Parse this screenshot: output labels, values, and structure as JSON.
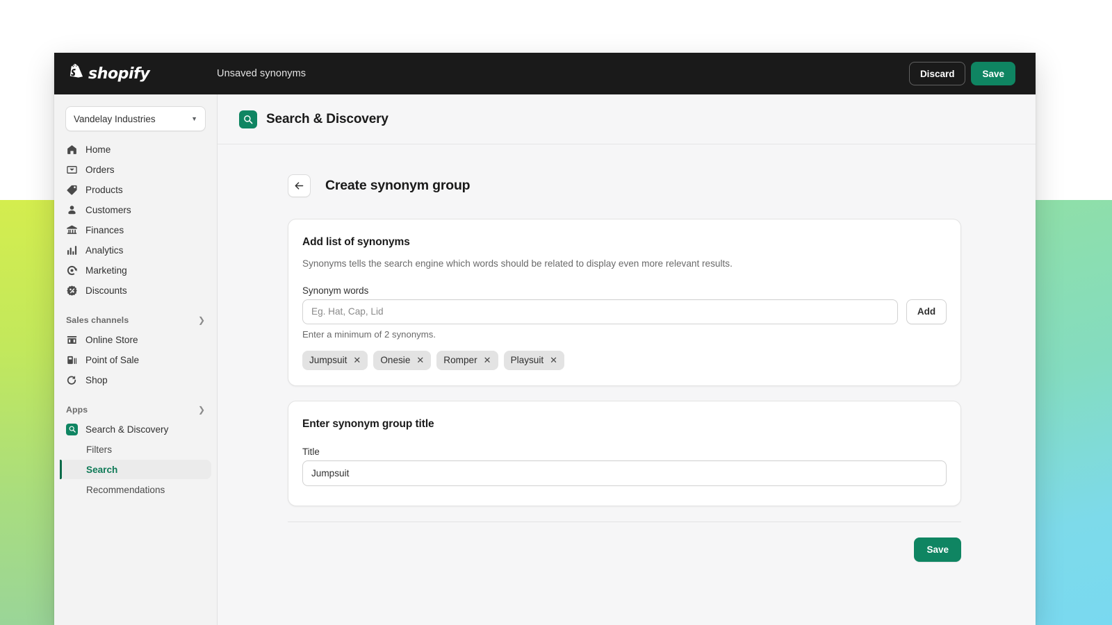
{
  "topbar": {
    "logo_text": "shopify",
    "logo_icon": "shopify-bag-icon",
    "title": "Unsaved synonyms",
    "discard_label": "Discard",
    "save_label": "Save"
  },
  "sidebar": {
    "store_name": "Vandelay Industries",
    "store_caret_icon": "caret-down-icon",
    "items": [
      {
        "label": "Home",
        "icon": "home-icon"
      },
      {
        "label": "Orders",
        "icon": "orders-inbox-icon"
      },
      {
        "label": "Products",
        "icon": "price-tag-icon"
      },
      {
        "label": "Customers",
        "icon": "person-icon"
      },
      {
        "label": "Finances",
        "icon": "bank-icon"
      },
      {
        "label": "Analytics",
        "icon": "bar-chart-icon"
      },
      {
        "label": "Marketing",
        "icon": "megaphone-target-icon"
      },
      {
        "label": "Discounts",
        "icon": "discount-percent-icon"
      }
    ],
    "sections": [
      {
        "label": "Sales channels",
        "chevron_icon": "chevron-right-icon",
        "items": [
          {
            "label": "Online Store",
            "icon": "storefront-icon"
          },
          {
            "label": "Point of Sale",
            "icon": "pos-terminal-icon"
          },
          {
            "label": "Shop",
            "icon": "shop-bag-icon"
          }
        ]
      },
      {
        "label": "Apps",
        "chevron_icon": "chevron-right-icon",
        "items": [
          {
            "label": "Search & Discovery",
            "icon": "search-discovery-app-icon"
          }
        ]
      }
    ],
    "sub_items": [
      {
        "label": "Filters",
        "active": false
      },
      {
        "label": "Search",
        "active": true
      },
      {
        "label": "Recommendations",
        "active": false
      }
    ]
  },
  "app_header": {
    "icon": "search-discovery-app-icon",
    "title": "Search & Discovery"
  },
  "page": {
    "back_icon": "arrow-left-icon",
    "title": "Create synonym group"
  },
  "synonyms_card": {
    "heading": "Add list of synonyms",
    "description": "Synonyms tells the search engine which words should be related to display even more relevant results.",
    "field_label": "Synonym words",
    "input_value": "",
    "input_placeholder": "Eg. Hat, Cap, Lid",
    "add_label": "Add",
    "help_text": "Enter a minimum of 2 synonyms.",
    "chips": [
      {
        "label": "Jumpsuit",
        "remove_icon": "close-icon"
      },
      {
        "label": "Onesie",
        "remove_icon": "close-icon"
      },
      {
        "label": "Romper",
        "remove_icon": "close-icon"
      },
      {
        "label": "Playsuit",
        "remove_icon": "close-icon"
      }
    ]
  },
  "title_card": {
    "heading": "Enter synonym group title",
    "field_label": "Title",
    "input_value": "Jumpsuit",
    "input_placeholder": ""
  },
  "footer": {
    "save_label": "Save"
  },
  "colors": {
    "brand_green": "#0f8562",
    "active_green": "#0f7a57",
    "topbar_black": "#1a1a1a",
    "chip_gray": "#e3e3e3",
    "canvas": "#f6f6f7"
  }
}
